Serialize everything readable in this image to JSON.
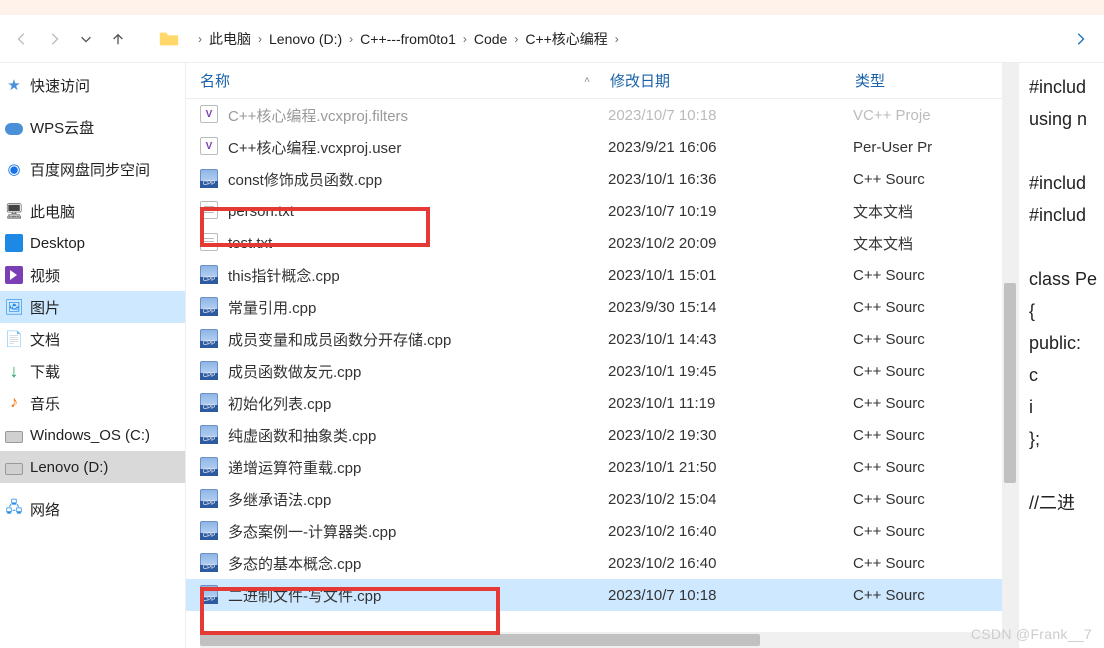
{
  "breadcrumb": [
    "此电脑",
    "Lenovo (D:)",
    "C++---from0to1",
    "Code",
    "C++核心编程"
  ],
  "sidebar": [
    {
      "icon": "star",
      "label": "快速访问"
    },
    {
      "icon": "cloud",
      "label": "WPS云盘"
    },
    {
      "icon": "baidu",
      "label": "百度网盘同步空间"
    },
    {
      "icon": "pc",
      "label": "此电脑"
    },
    {
      "icon": "blue",
      "label": "Desktop"
    },
    {
      "icon": "video",
      "label": "视频"
    },
    {
      "icon": "pictures",
      "label": "图片",
      "cls": "pictures"
    },
    {
      "icon": "doc",
      "label": "文档"
    },
    {
      "icon": "down",
      "label": "下载"
    },
    {
      "icon": "music",
      "label": "音乐"
    },
    {
      "icon": "drive",
      "label": "Windows_OS (C:)"
    },
    {
      "icon": "drive",
      "label": "Lenovo (D:)",
      "cls": "selected"
    },
    {
      "icon": "net",
      "label": "网络"
    }
  ],
  "columns": {
    "name": "名称",
    "date": "修改日期",
    "type": "类型"
  },
  "files": [
    {
      "icon": "proj",
      "name": "C++核心编程.vcxproj.filters",
      "date": "2023/10/7 10:18",
      "type": "VC++ Proje",
      "cut": true
    },
    {
      "icon": "proj",
      "name": "C++核心编程.vcxproj.user",
      "date": "2023/9/21 16:06",
      "type": "Per-User Pr"
    },
    {
      "icon": "cpp",
      "name": "const修饰成员函数.cpp",
      "date": "2023/10/1 16:36",
      "type": "C++ Sourc"
    },
    {
      "icon": "txt",
      "name": "person.txt",
      "date": "2023/10/7 10:19",
      "type": "文本文档",
      "hl": 1
    },
    {
      "icon": "txt",
      "name": "test.txt",
      "date": "2023/10/2 20:09",
      "type": "文本文档"
    },
    {
      "icon": "cpp",
      "name": "this指针概念.cpp",
      "date": "2023/10/1 15:01",
      "type": "C++ Sourc"
    },
    {
      "icon": "cpp",
      "name": "常量引用.cpp",
      "date": "2023/9/30 15:14",
      "type": "C++ Sourc"
    },
    {
      "icon": "cpp",
      "name": "成员变量和成员函数分开存储.cpp",
      "date": "2023/10/1 14:43",
      "type": "C++ Sourc"
    },
    {
      "icon": "cpp",
      "name": "成员函数做友元.cpp",
      "date": "2023/10/1 19:45",
      "type": "C++ Sourc"
    },
    {
      "icon": "cpp",
      "name": "初始化列表.cpp",
      "date": "2023/10/1 11:19",
      "type": "C++ Sourc"
    },
    {
      "icon": "cpp",
      "name": "纯虚函数和抽象类.cpp",
      "date": "2023/10/2 19:30",
      "type": "C++ Sourc"
    },
    {
      "icon": "cpp",
      "name": "递增运算符重载.cpp",
      "date": "2023/10/1 21:50",
      "type": "C++ Sourc"
    },
    {
      "icon": "cpp",
      "name": "多继承语法.cpp",
      "date": "2023/10/2 15:04",
      "type": "C++ Sourc"
    },
    {
      "icon": "cpp",
      "name": "多态案例一-计算器类.cpp",
      "date": "2023/10/2 16:40",
      "type": "C++ Sourc"
    },
    {
      "icon": "cpp",
      "name": "多态的基本概念.cpp",
      "date": "2023/10/2 16:40",
      "type": "C++ Sourc"
    },
    {
      "icon": "cpp",
      "name": "二进制文件-写文件.cpp",
      "date": "2023/10/7 10:18",
      "type": "C++ Sourc",
      "sel": true,
      "hl": 2
    }
  ],
  "preview": [
    "#includ",
    "using n",
    "",
    "#includ",
    "#includ",
    "",
    "class Pe",
    "{",
    "public:",
    "      c",
    "      i",
    "};",
    "",
    "//二进"
  ],
  "watermark": "CSDN @Frank__7"
}
